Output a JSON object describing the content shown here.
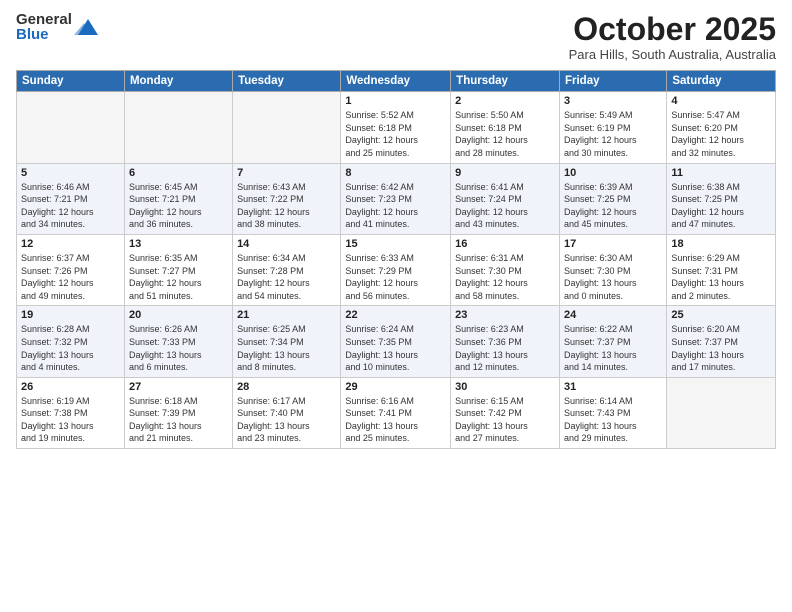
{
  "logo": {
    "general": "General",
    "blue": "Blue"
  },
  "header": {
    "month": "October 2025",
    "location": "Para Hills, South Australia, Australia"
  },
  "weekdays": [
    "Sunday",
    "Monday",
    "Tuesday",
    "Wednesday",
    "Thursday",
    "Friday",
    "Saturday"
  ],
  "weeks": [
    [
      {
        "day": "",
        "info": ""
      },
      {
        "day": "",
        "info": ""
      },
      {
        "day": "",
        "info": ""
      },
      {
        "day": "1",
        "info": "Sunrise: 5:52 AM\nSunset: 6:18 PM\nDaylight: 12 hours\nand 25 minutes."
      },
      {
        "day": "2",
        "info": "Sunrise: 5:50 AM\nSunset: 6:18 PM\nDaylight: 12 hours\nand 28 minutes."
      },
      {
        "day": "3",
        "info": "Sunrise: 5:49 AM\nSunset: 6:19 PM\nDaylight: 12 hours\nand 30 minutes."
      },
      {
        "day": "4",
        "info": "Sunrise: 5:47 AM\nSunset: 6:20 PM\nDaylight: 12 hours\nand 32 minutes."
      }
    ],
    [
      {
        "day": "5",
        "info": "Sunrise: 6:46 AM\nSunset: 7:21 PM\nDaylight: 12 hours\nand 34 minutes."
      },
      {
        "day": "6",
        "info": "Sunrise: 6:45 AM\nSunset: 7:21 PM\nDaylight: 12 hours\nand 36 minutes."
      },
      {
        "day": "7",
        "info": "Sunrise: 6:43 AM\nSunset: 7:22 PM\nDaylight: 12 hours\nand 38 minutes."
      },
      {
        "day": "8",
        "info": "Sunrise: 6:42 AM\nSunset: 7:23 PM\nDaylight: 12 hours\nand 41 minutes."
      },
      {
        "day": "9",
        "info": "Sunrise: 6:41 AM\nSunset: 7:24 PM\nDaylight: 12 hours\nand 43 minutes."
      },
      {
        "day": "10",
        "info": "Sunrise: 6:39 AM\nSunset: 7:25 PM\nDaylight: 12 hours\nand 45 minutes."
      },
      {
        "day": "11",
        "info": "Sunrise: 6:38 AM\nSunset: 7:25 PM\nDaylight: 12 hours\nand 47 minutes."
      }
    ],
    [
      {
        "day": "12",
        "info": "Sunrise: 6:37 AM\nSunset: 7:26 PM\nDaylight: 12 hours\nand 49 minutes."
      },
      {
        "day": "13",
        "info": "Sunrise: 6:35 AM\nSunset: 7:27 PM\nDaylight: 12 hours\nand 51 minutes."
      },
      {
        "day": "14",
        "info": "Sunrise: 6:34 AM\nSunset: 7:28 PM\nDaylight: 12 hours\nand 54 minutes."
      },
      {
        "day": "15",
        "info": "Sunrise: 6:33 AM\nSunset: 7:29 PM\nDaylight: 12 hours\nand 56 minutes."
      },
      {
        "day": "16",
        "info": "Sunrise: 6:31 AM\nSunset: 7:30 PM\nDaylight: 12 hours\nand 58 minutes."
      },
      {
        "day": "17",
        "info": "Sunrise: 6:30 AM\nSunset: 7:30 PM\nDaylight: 13 hours\nand 0 minutes."
      },
      {
        "day": "18",
        "info": "Sunrise: 6:29 AM\nSunset: 7:31 PM\nDaylight: 13 hours\nand 2 minutes."
      }
    ],
    [
      {
        "day": "19",
        "info": "Sunrise: 6:28 AM\nSunset: 7:32 PM\nDaylight: 13 hours\nand 4 minutes."
      },
      {
        "day": "20",
        "info": "Sunrise: 6:26 AM\nSunset: 7:33 PM\nDaylight: 13 hours\nand 6 minutes."
      },
      {
        "day": "21",
        "info": "Sunrise: 6:25 AM\nSunset: 7:34 PM\nDaylight: 13 hours\nand 8 minutes."
      },
      {
        "day": "22",
        "info": "Sunrise: 6:24 AM\nSunset: 7:35 PM\nDaylight: 13 hours\nand 10 minutes."
      },
      {
        "day": "23",
        "info": "Sunrise: 6:23 AM\nSunset: 7:36 PM\nDaylight: 13 hours\nand 12 minutes."
      },
      {
        "day": "24",
        "info": "Sunrise: 6:22 AM\nSunset: 7:37 PM\nDaylight: 13 hours\nand 14 minutes."
      },
      {
        "day": "25",
        "info": "Sunrise: 6:20 AM\nSunset: 7:37 PM\nDaylight: 13 hours\nand 17 minutes."
      }
    ],
    [
      {
        "day": "26",
        "info": "Sunrise: 6:19 AM\nSunset: 7:38 PM\nDaylight: 13 hours\nand 19 minutes."
      },
      {
        "day": "27",
        "info": "Sunrise: 6:18 AM\nSunset: 7:39 PM\nDaylight: 13 hours\nand 21 minutes."
      },
      {
        "day": "28",
        "info": "Sunrise: 6:17 AM\nSunset: 7:40 PM\nDaylight: 13 hours\nand 23 minutes."
      },
      {
        "day": "29",
        "info": "Sunrise: 6:16 AM\nSunset: 7:41 PM\nDaylight: 13 hours\nand 25 minutes."
      },
      {
        "day": "30",
        "info": "Sunrise: 6:15 AM\nSunset: 7:42 PM\nDaylight: 13 hours\nand 27 minutes."
      },
      {
        "day": "31",
        "info": "Sunrise: 6:14 AM\nSunset: 7:43 PM\nDaylight: 13 hours\nand 29 minutes."
      },
      {
        "day": "",
        "info": ""
      }
    ]
  ]
}
